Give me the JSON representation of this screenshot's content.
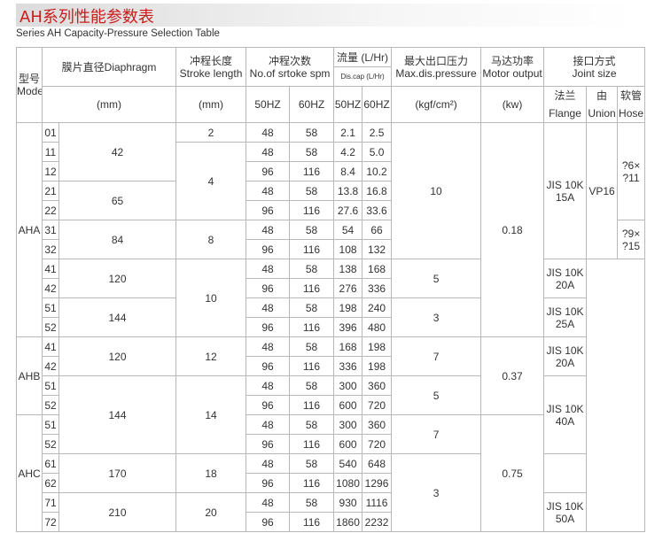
{
  "title": "AH系列性能参数表",
  "subtitle": "Series AH Capacity-Pressure Selection Table",
  "header": {
    "model": [
      "型号",
      "Model"
    ],
    "diaphragm": [
      "膜片直径Diaphragm",
      "(mm)"
    ],
    "stroke": [
      "冲程长度",
      "Stroke length",
      "(mm)"
    ],
    "spm": [
      "冲程次数",
      "No.of srtoke spm",
      "50HZ",
      "60HZ"
    ],
    "flow": [
      "流量 (L/Hr)",
      "Dis.cap (L/Hr)",
      "50HZ",
      "60HZ"
    ],
    "pressure": [
      "最大出口压力",
      "Max.dis.pressure",
      "(kgf/cm²)"
    ],
    "motor": [
      "马达功率",
      "Motor output",
      "(kw)"
    ],
    "joint": [
      "接口方式",
      "Joint size"
    ],
    "flange": [
      "法兰",
      "Flange"
    ],
    "union": [
      "由",
      "Union"
    ],
    "hose": [
      "软管",
      "Hose"
    ]
  },
  "groups": [
    "AHA",
    "AHB",
    "AHC"
  ],
  "rows": [
    {
      "code": "01",
      "spm50": "48",
      "spm60": "58",
      "f50": "2.1",
      "f60": "2.5"
    },
    {
      "code": "11",
      "spm50": "48",
      "spm60": "58",
      "f50": "4.2",
      "f60": "5.0"
    },
    {
      "code": "12",
      "spm50": "96",
      "spm60": "116",
      "f50": "8.4",
      "f60": "10.2"
    },
    {
      "code": "21",
      "spm50": "48",
      "spm60": "58",
      "f50": "13.8",
      "f60": "16.8"
    },
    {
      "code": "22",
      "spm50": "96",
      "spm60": "116",
      "f50": "27.6",
      "f60": "33.6"
    },
    {
      "code": "31",
      "spm50": "48",
      "spm60": "58",
      "f50": "54",
      "f60": "66"
    },
    {
      "code": "32",
      "spm50": "96",
      "spm60": "116",
      "f50": "108",
      "f60": "132"
    },
    {
      "code": "41",
      "spm50": "48",
      "spm60": "58",
      "f50": "138",
      "f60": "168"
    },
    {
      "code": "42",
      "spm50": "96",
      "spm60": "116",
      "f50": "276",
      "f60": "336"
    },
    {
      "code": "51",
      "spm50": "48",
      "spm60": "58",
      "f50": "198",
      "f60": "240"
    },
    {
      "code": "52",
      "spm50": "96",
      "spm60": "116",
      "f50": "396",
      "f60": "480"
    },
    {
      "code": "41",
      "spm50": "48",
      "spm60": "58",
      "f50": "168",
      "f60": "198"
    },
    {
      "code": "42",
      "spm50": "96",
      "spm60": "116",
      "f50": "336",
      "f60": "198"
    },
    {
      "code": "51",
      "spm50": "48",
      "spm60": "58",
      "f50": "300",
      "f60": "360"
    },
    {
      "code": "52",
      "spm50": "96",
      "spm60": "116",
      "f50": "600",
      "f60": "720"
    },
    {
      "code": "51",
      "spm50": "48",
      "spm60": "58",
      "f50": "300",
      "f60": "360"
    },
    {
      "code": "52",
      "spm50": "96",
      "spm60": "116",
      "f50": "600",
      "f60": "720"
    },
    {
      "code": "61",
      "spm50": "48",
      "spm60": "58",
      "f50": "540",
      "f60": "648"
    },
    {
      "code": "62",
      "spm50": "96",
      "spm60": "116",
      "f50": "1080",
      "f60": "1296"
    },
    {
      "code": "71",
      "spm50": "48",
      "spm60": "58",
      "f50": "930",
      "f60": "1116"
    },
    {
      "code": "72",
      "spm50": "96",
      "spm60": "116",
      "f50": "1860",
      "f60": "2232"
    }
  ],
  "diaphragm": [
    "42",
    "65",
    "84",
    "120",
    "144",
    "120",
    "144",
    "170",
    "210"
  ],
  "stroke": [
    "2",
    "4",
    "8",
    "10",
    "12",
    "14",
    "18",
    "20"
  ],
  "pressure": [
    "10",
    "5",
    "3",
    "7",
    "5",
    "7",
    "3"
  ],
  "motor": [
    "0.18",
    "0.37",
    "0.75"
  ],
  "flange": [
    [
      "JIS 10K",
      "15A"
    ],
    [
      "JIS 10K",
      "20A"
    ],
    [
      "JIS 10K",
      "25A"
    ],
    [
      "JIS 10K",
      "20A"
    ],
    [
      "JIS 10K",
      "40A"
    ],
    [
      "JIS 10K",
      "50A"
    ]
  ],
  "union": "VP16",
  "hose": [
    [
      "?6×",
      "?11"
    ],
    [
      "?9×",
      "?15"
    ]
  ]
}
